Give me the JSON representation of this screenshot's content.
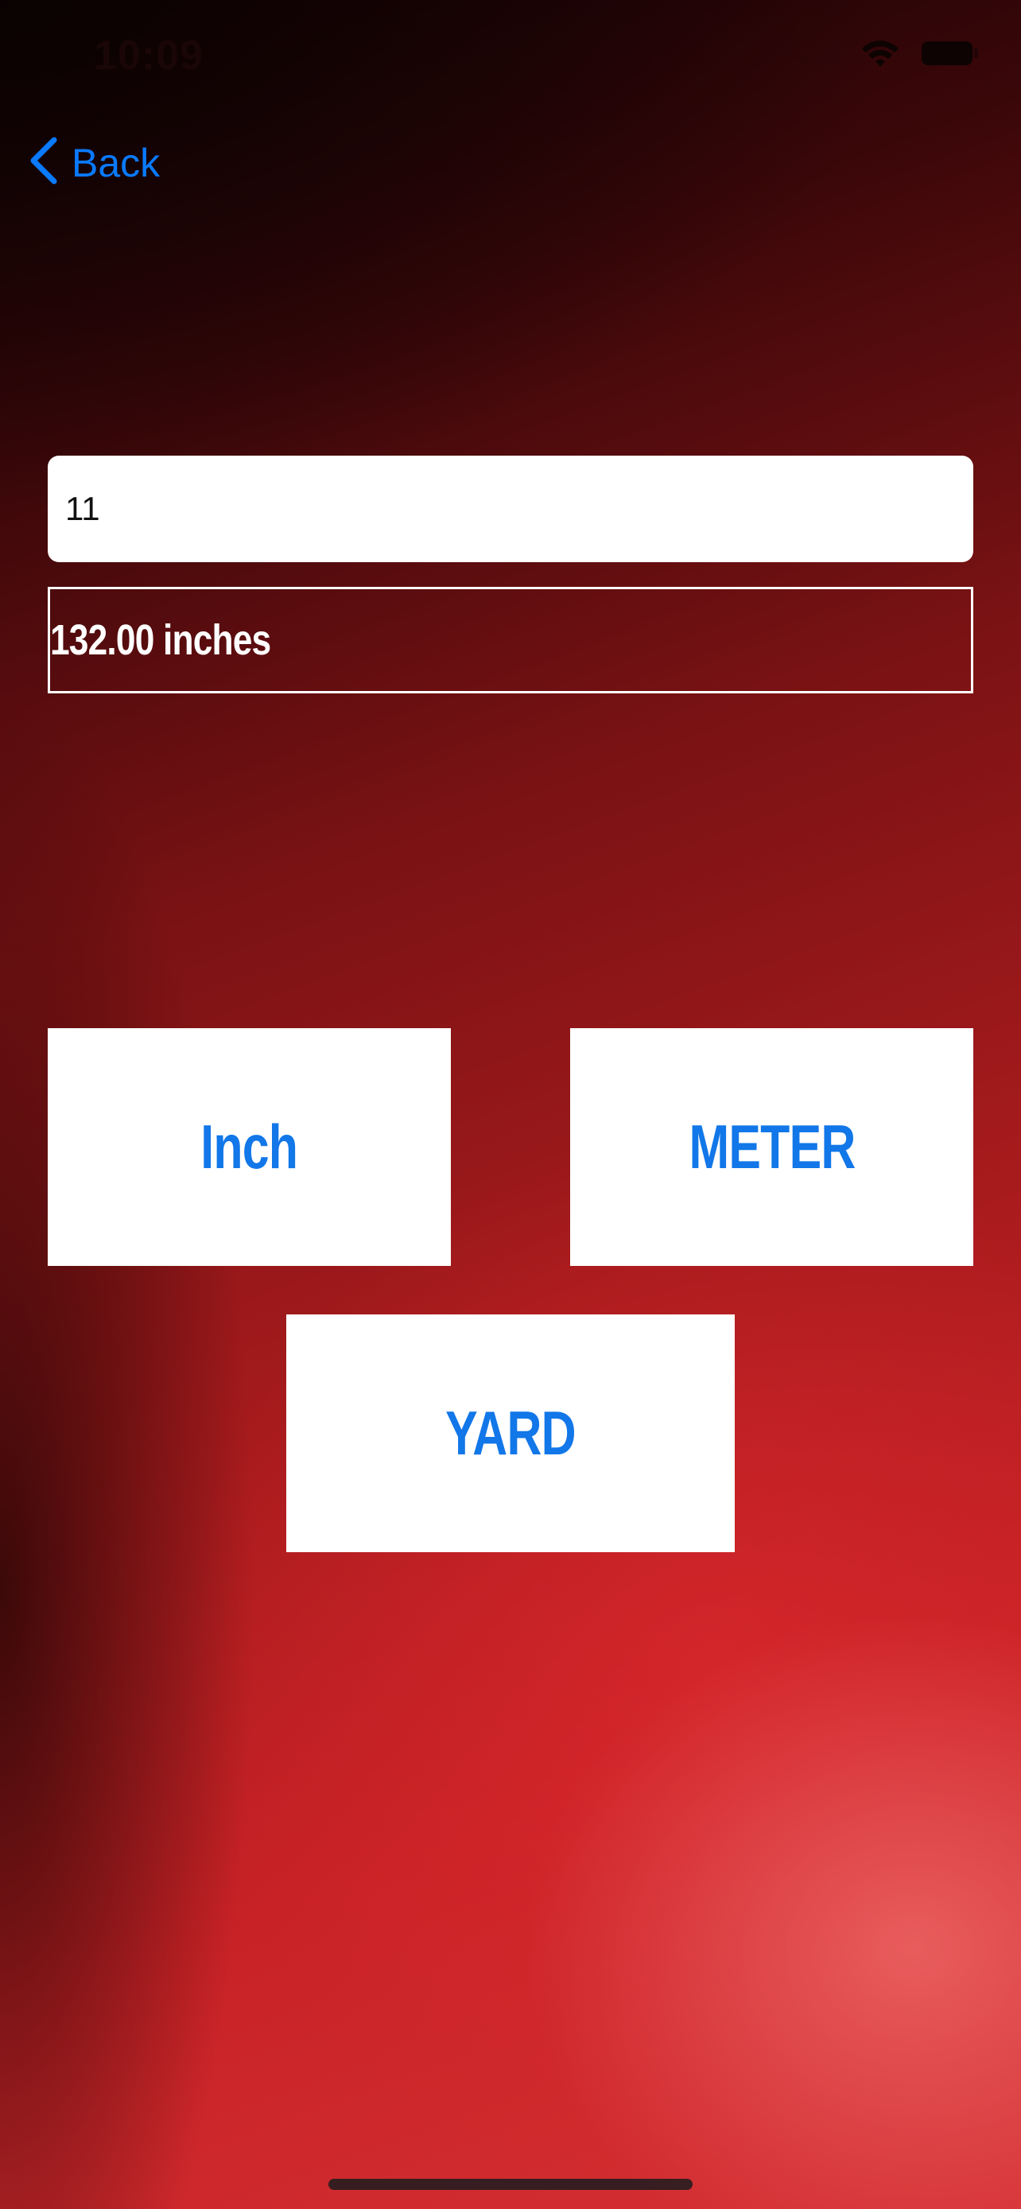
{
  "status_bar": {
    "time": "10:09"
  },
  "nav": {
    "back_label": "Back",
    "accent_color": "#0a7aff"
  },
  "converter": {
    "input_value": "11",
    "result_text": "132.00 inches"
  },
  "buttons": {
    "inch_label": "Inch",
    "meter_label": "METER",
    "yard_label": "YARD",
    "label_color": "#1277e8"
  },
  "icons": {
    "back": "chevron-left-icon",
    "signal": "cellular-signal-icon",
    "wifi": "wifi-icon",
    "battery": "battery-icon"
  }
}
